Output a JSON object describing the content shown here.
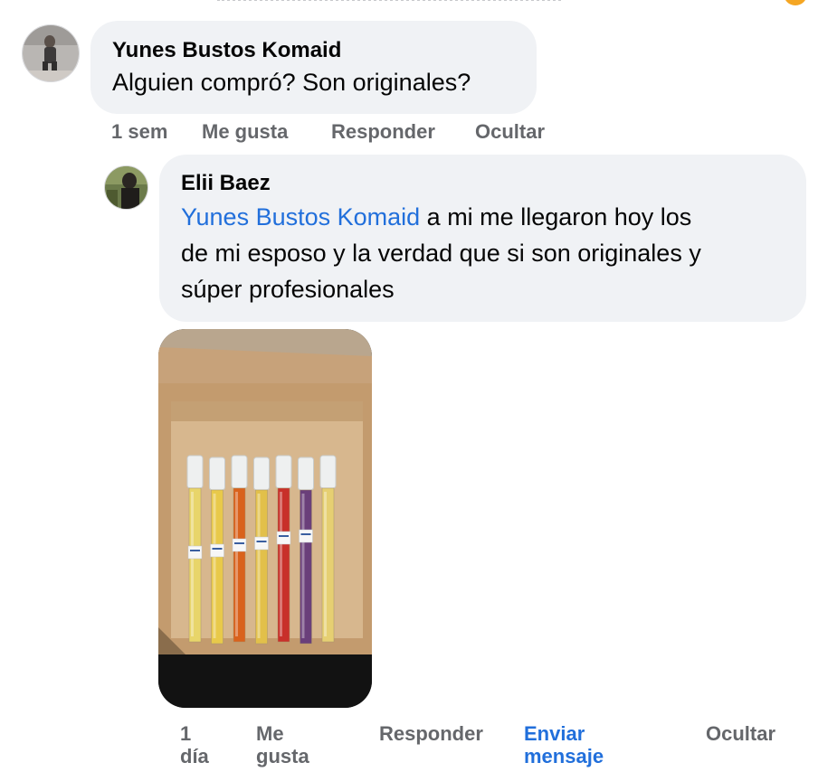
{
  "comment": {
    "author": "Yunes Bustos Komaid",
    "text": "Alguien compró? Son originales?",
    "actions": {
      "time": "1 sem",
      "like": "Me gusta",
      "reply": "Responder",
      "hide": "Ocultar"
    }
  },
  "reply": {
    "author": "Elii Baez",
    "mention": "Yunes Bustos Komaid",
    "text_line1": " a mi me llegaron hoy los",
    "text_line2": "de mi esposo y la verdad que si son originales y",
    "text_line3": "súper profesionales",
    "photo": {
      "vials": [
        {
          "liquid": "#e8d56a",
          "label": true
        },
        {
          "liquid": "#e8c94a",
          "label": true
        },
        {
          "liquid": "#d9621c",
          "label": true
        },
        {
          "liquid": "#e2c04a",
          "label": true
        },
        {
          "liquid": "#c8302a",
          "label": true
        },
        {
          "liquid": "#6a3f7a",
          "label": true
        },
        {
          "liquid": "#e6cf72",
          "label": false
        }
      ]
    },
    "actions": {
      "time_1": "1",
      "time_2": "día",
      "like_1": "Me",
      "like_2": "gusta",
      "reply": "Responder",
      "message_1": "Enviar",
      "message_2": "mensaje",
      "hide": "Ocultar"
    }
  },
  "colors": {
    "bubble": "#f0f2f5",
    "link": "#216fdb",
    "secondary_text": "#65676b"
  }
}
